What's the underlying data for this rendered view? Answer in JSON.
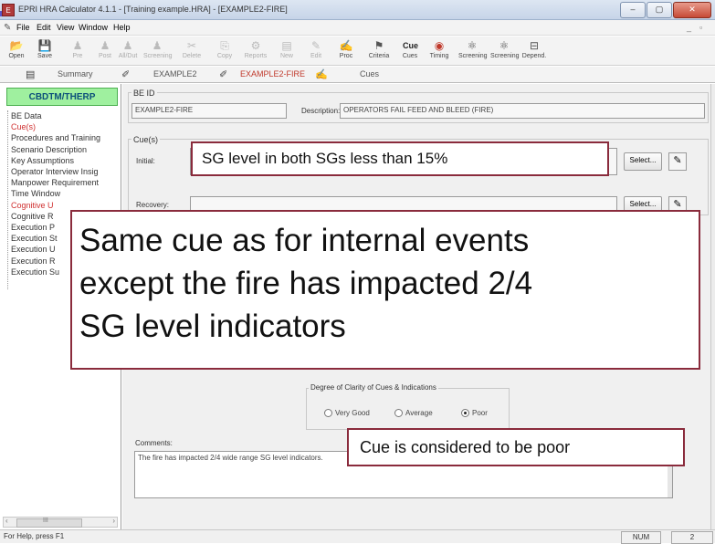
{
  "window": {
    "title": "EPRI HRA Calculator 4.1.1 - [Training example.HRA] - [EXAMPLE2-FIRE]",
    "app_icon_label": "E",
    "btn_min": "–",
    "btn_max": "▢",
    "btn_close": "✕"
  },
  "menu": [
    "File",
    "Edit",
    "View",
    "Window",
    "Help"
  ],
  "toolbar": [
    {
      "label": "Open",
      "icon": "folder-open-icon",
      "glyph": "📂",
      "enabled": true
    },
    {
      "label": "Save",
      "icon": "save-icon",
      "glyph": "💾",
      "enabled": true
    },
    {
      "label": "Pre",
      "icon": "person-icon",
      "glyph": "♟",
      "enabled": false
    },
    {
      "label": "Post",
      "icon": "person-icon",
      "glyph": "♟",
      "enabled": false
    },
    {
      "label": "All/Dut",
      "icon": "person-icon",
      "glyph": "♟",
      "enabled": false
    },
    {
      "label": "Screening",
      "icon": "person-icon",
      "glyph": "♟",
      "enabled": false
    },
    {
      "label": "Delete",
      "icon": "cut-icon",
      "glyph": "✂",
      "enabled": false
    },
    {
      "label": "Copy",
      "icon": "copy-icon",
      "glyph": "⎘",
      "enabled": false
    },
    {
      "label": "Reports",
      "icon": "reports-icon",
      "glyph": "⚙",
      "enabled": false
    },
    {
      "label": "New",
      "icon": "new-icon",
      "glyph": "▤",
      "enabled": false
    },
    {
      "label": "Edit",
      "icon": "pencil-icon",
      "glyph": "✎",
      "enabled": false
    },
    {
      "label": "Proc",
      "icon": "procedure-icon",
      "glyph": "✍",
      "enabled": true
    },
    {
      "label": "Criteria",
      "icon": "criteria-icon",
      "glyph": "⚑",
      "enabled": true
    },
    {
      "label": "Cues",
      "icon": "cues-icon",
      "glyph": "Cue",
      "enabled": true
    },
    {
      "label": "Timing",
      "icon": "timing-icon",
      "glyph": "◉",
      "enabled": true
    },
    {
      "label": "Screening",
      "icon": "screening-icon",
      "glyph": "⚛",
      "enabled": true
    },
    {
      "label": "Screening",
      "icon": "screening-icon",
      "glyph": "⚛",
      "enabled": true
    },
    {
      "label": "Depend.",
      "icon": "dependency-icon",
      "glyph": "⊟",
      "enabled": true
    }
  ],
  "tabs": [
    {
      "label": "Summary",
      "active": false
    },
    {
      "label": "EXAMPLE2",
      "active": false
    },
    {
      "label": "EXAMPLE2-FIRE",
      "active": true
    },
    {
      "label": "Cues",
      "active": false
    }
  ],
  "left_panel": {
    "header": "CBDTM/THERP",
    "items": [
      {
        "label": "BE Data",
        "red": false
      },
      {
        "label": "Cue(s)",
        "red": true
      },
      {
        "label": "Procedures and Training",
        "red": false
      },
      {
        "label": "Scenario Description",
        "red": false
      },
      {
        "label": "Key Assumptions",
        "red": false
      },
      {
        "label": "Operator Interview Insig",
        "red": false
      },
      {
        "label": "Manpower Requirement",
        "red": false
      },
      {
        "label": "Time Window",
        "red": false
      },
      {
        "label": "Cognitive U",
        "red": true
      },
      {
        "label": "Cognitive R",
        "red": false
      },
      {
        "label": "Execution P",
        "red": false
      },
      {
        "label": "Execution St",
        "red": false
      },
      {
        "label": "Execution U",
        "red": false
      },
      {
        "label": "Execution R",
        "red": false
      },
      {
        "label": "Execution Su",
        "red": false
      }
    ],
    "scroll_mark": "III"
  },
  "be": {
    "group_label": "BE ID",
    "id_value": "EXAMPLE2-FIRE",
    "description_label": "Description:",
    "description_value": "OPERATORS FAIL FEED AND BLEED (FIRE)"
  },
  "cues": {
    "group_label": "Cue(s)",
    "initial_label": "Initial:",
    "recovery_label": "Recovery:",
    "select_label": "Select..."
  },
  "clarity": {
    "label": "Degree of Clarity of Cues & Indications",
    "options": [
      "Very Good",
      "Average",
      "Poor"
    ],
    "selected": "Poor"
  },
  "comments": {
    "label": "Comments:",
    "value": "The fire has impacted 2/4 wide range SG level indicators."
  },
  "status": {
    "help": "For Help, press F1",
    "num": "NUM",
    "page": "2"
  },
  "callouts": {
    "initial_cue": "SG level in both SGs less than 15%",
    "main_lines": [
      "Same cue as for internal events",
      "except the fire has impacted 2/4",
      "SG level indicators"
    ],
    "poor_note": "Cue is considered to be poor"
  }
}
